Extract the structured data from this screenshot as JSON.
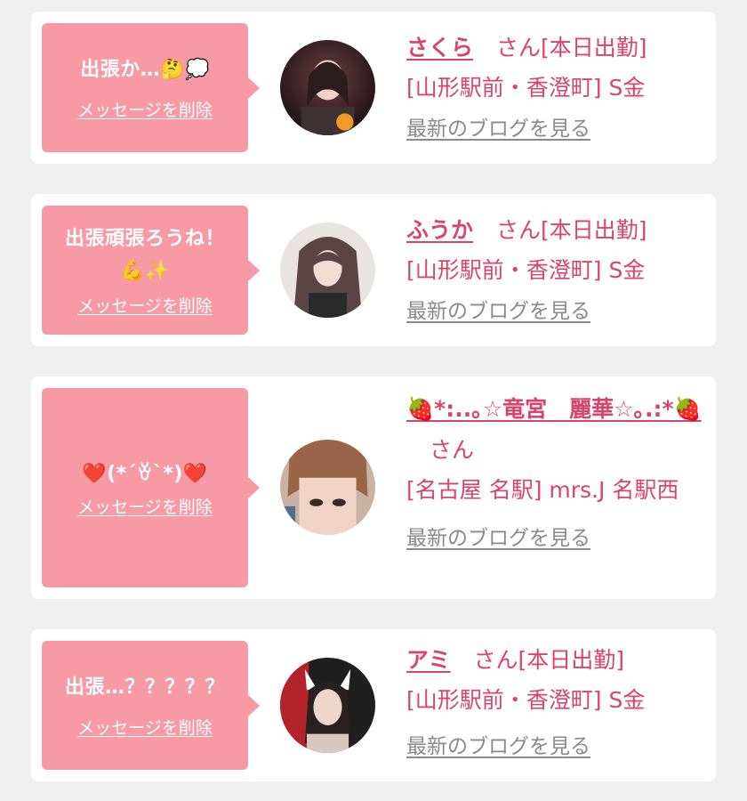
{
  "cards": [
    {
      "message": "出張か…🤔💭",
      "message_line2": "",
      "delete_label": "メッセージを削除",
      "name": "さくら",
      "suffix": "さん[本日出勤]",
      "name_cont": "",
      "shop": "[山形駅前・香澄町] S金",
      "shop_cont": "",
      "blog_label": "最新のブログを見る",
      "avatar_icon": "photo-avatar"
    },
    {
      "message": "出張頑張ろうね！",
      "message_line2": "💪✨",
      "delete_label": "メッセージを削除",
      "name": "ふうか",
      "suffix": "さん[本日出勤]",
      "name_cont": "",
      "shop": "[山形駅前・香澄町] S金",
      "shop_cont": "",
      "blog_label": "最新のブログを見る",
      "avatar_icon": "photo-avatar"
    },
    {
      "message": "❤️(*´ꈊ`*)❤️",
      "message_line2": "",
      "delete_label": "メッセージを削除",
      "name": "🍓*:..｡☆竜宮　麗華☆｡.:*🍓",
      "suffix": "さん",
      "name_cont": "",
      "shop": "[名古屋 名駅] mrs.J 名駅西",
      "shop_cont": "",
      "blog_label": "最新のブログを見る",
      "avatar_icon": "photo-avatar"
    },
    {
      "message": "出張…？？？？？",
      "message_line2": "",
      "delete_label": "メッセージを削除",
      "name": "アミ",
      "suffix": "さん[本日出勤]",
      "name_cont": "",
      "shop": "[山形駅前・香澄町] S金",
      "shop_cont": "",
      "blog_label": "最新のブログを見る",
      "avatar_icon": "photo-avatar"
    }
  ],
  "colors": {
    "bubble": "#f79aa6",
    "accent": "#d9456a",
    "muted": "#8a8a8a",
    "background": "#efefef"
  }
}
